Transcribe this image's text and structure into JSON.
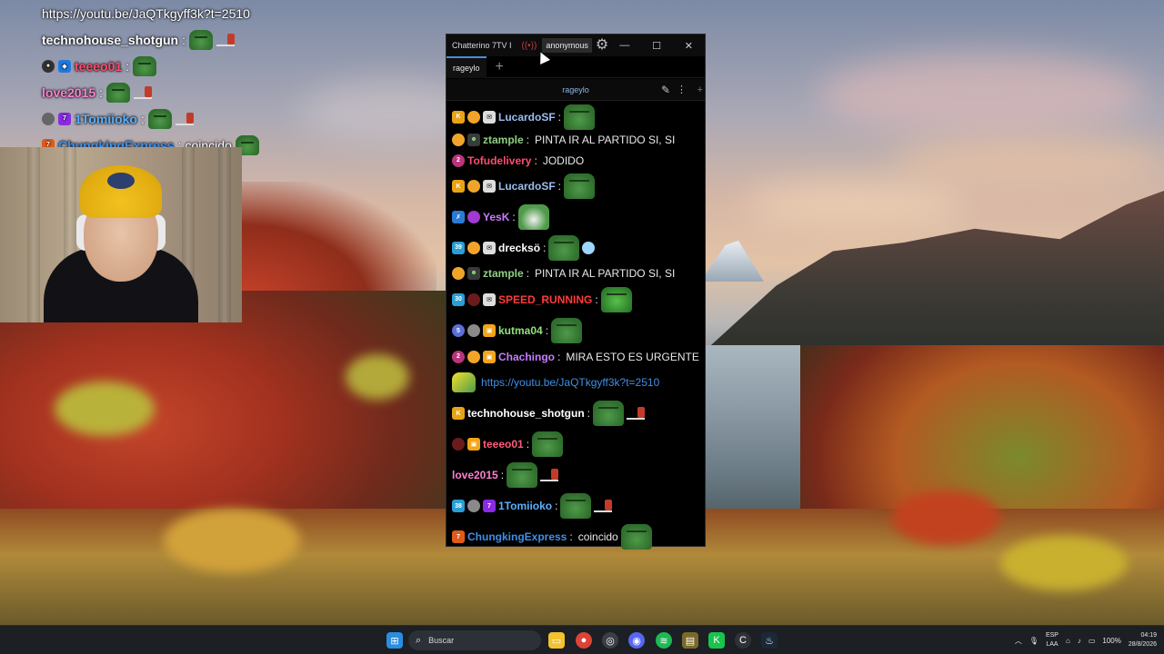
{
  "overlay_chat": {
    "lines": [
      {
        "name": "",
        "text": "https://youtu.be/JaQTkgyff3k?t=2510"
      },
      {
        "name": "technohouse_shotgun",
        "text": ""
      },
      {
        "name": "teeeo01",
        "text": ""
      },
      {
        "name": "love2015",
        "text": ""
      },
      {
        "name": "1Tomiioko",
        "text": ""
      },
      {
        "name": "ChungkingExpress",
        "text": "coincido"
      }
    ]
  },
  "chatterino": {
    "title": "Chatterino 7TV I",
    "user": "anonymous",
    "tab": "rageylo",
    "channel": "rageylo",
    "messages": [
      {
        "name": "LucardoSF",
        "color": "#9dbdf0",
        "text": ""
      },
      {
        "name": "ztample",
        "color": "#8fd083",
        "text": "PINTA IR AL PARTIDO SI, SI"
      },
      {
        "name": "Tofudelivery",
        "color": "#ff4d6d",
        "text": "JODIDO"
      },
      {
        "name": "LucardoSF",
        "color": "#9dbdf0",
        "text": ""
      },
      {
        "name": "YesK",
        "color": "#c77dff",
        "text": ""
      },
      {
        "name": "drecksö",
        "color": "#ffffff",
        "text": ""
      },
      {
        "name": "ztample",
        "color": "#8fd083",
        "text": "PINTA IR AL PARTIDO SI, SI"
      },
      {
        "name": "SPEED_RUNNING",
        "color": "#ff3b3b",
        "text": ""
      },
      {
        "name": "kutma04",
        "color": "#8fe37a",
        "text": ""
      },
      {
        "name": "Chachingo",
        "color": "#c77dff",
        "text": "MIRA ESTO ES URGENTE"
      },
      {
        "name": "",
        "color": "#3f8fe8",
        "text": "https://youtu.be/JaQTkgyff3k?t=2510"
      },
      {
        "name": "technohouse_shotgun",
        "color": "#ffffff",
        "text": ""
      },
      {
        "name": "teeeo01",
        "color": "#ff5a7a",
        "text": ""
      },
      {
        "name": "love2015",
        "color": "#ff7fd1",
        "text": ""
      },
      {
        "name": "1Tomiioko",
        "color": "#5ab0ff",
        "text": ""
      },
      {
        "name": "ChungkingExpress",
        "color": "#3f8fe8",
        "text": "coincido"
      }
    ]
  },
  "taskbar": {
    "search_placeholder": "Buscar",
    "lang_top": "ESP",
    "lang_bottom": "LAA",
    "battery": "100%",
    "time": "04:19",
    "date": "28/8/2026"
  }
}
